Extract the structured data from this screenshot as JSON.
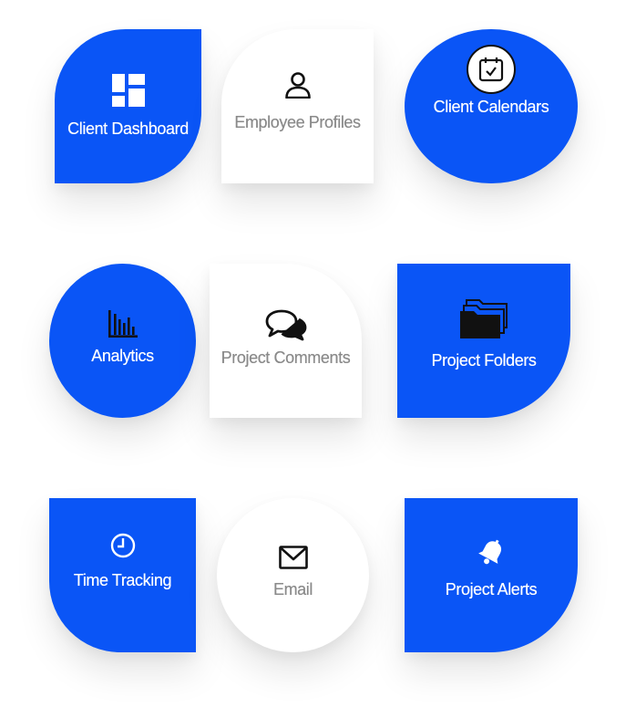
{
  "colors": {
    "accent": "#0a55f6",
    "muted_text": "#8a8a8a",
    "icon_dark": "#111111"
  },
  "tiles": [
    {
      "label": "Client Dashboard",
      "icon": "dashboard-icon",
      "style": "blue"
    },
    {
      "label": "Employee Profiles",
      "icon": "user-icon",
      "style": "white"
    },
    {
      "label": "Client Calendars",
      "icon": "calendar-check-icon",
      "style": "blue"
    },
    {
      "label": "Analytics",
      "icon": "bar-chart-icon",
      "style": "blue"
    },
    {
      "label": "Project Comments",
      "icon": "comments-icon",
      "style": "white"
    },
    {
      "label": "Project Folders",
      "icon": "folders-icon",
      "style": "blue"
    },
    {
      "label": "Time Tracking",
      "icon": "clock-icon",
      "style": "blue"
    },
    {
      "label": "Email",
      "icon": "envelope-icon",
      "style": "white"
    },
    {
      "label": "Project Alerts",
      "icon": "bell-icon",
      "style": "blue"
    }
  ]
}
